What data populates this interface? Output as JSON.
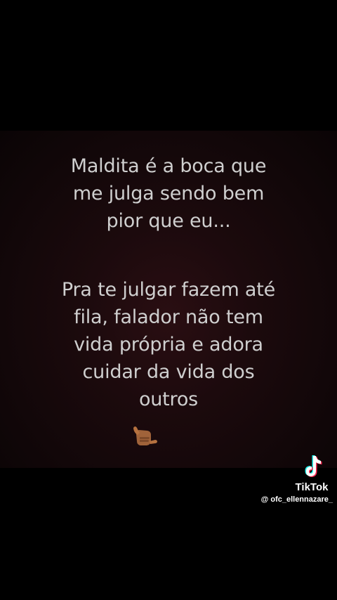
{
  "post": {
    "quote_part1": [
      "Maldita é a boca que",
      "me julga sendo bem",
      "pior que eu..."
    ],
    "quote_part2": [
      "Pra te julgar fazem até",
      "fila, falador não tem",
      "vida própria e adora",
      "cuidar da vida dos",
      "outros"
    ],
    "emoji_icon": "call-me-hand-icon",
    "text_color": "#cfcfcf",
    "background_color": "#1a0a0d"
  },
  "watermark": {
    "brand": "TikTok",
    "handle": "@ ofc_ellennazare_",
    "logo_icon": "tiktok-note-icon"
  }
}
